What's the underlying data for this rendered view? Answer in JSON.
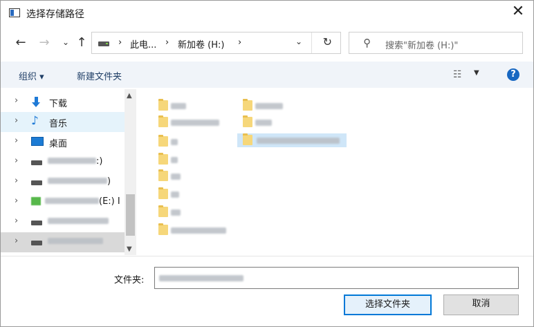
{
  "window": {
    "title": "选择存储路径",
    "close_icon": "close-icon"
  },
  "nav": {
    "back_icon": "←",
    "forward_icon": "→",
    "recent_icon": "⌄",
    "up_icon": "↑",
    "breadcrumb": [
      "此电...",
      "新加卷 (H:)"
    ],
    "breadcrumb_sep": "›",
    "dropdown_icon": "⌄",
    "refresh_icon": "↻"
  },
  "search": {
    "placeholder": "搜索\"新加卷 (H:)\""
  },
  "commandbar": {
    "organize": "组织 ▾",
    "new_folder": "新建文件夹",
    "view_dropdown": "▼",
    "help": "?"
  },
  "tree": {
    "items": [
      {
        "label": "下载",
        "icon": "download-icon"
      },
      {
        "label": "音乐",
        "icon": "music-icon"
      },
      {
        "label": "桌面",
        "icon": "desktop-icon"
      },
      {
        "label": ":)",
        "icon": "drive-icon"
      },
      {
        "label": ")",
        "icon": "drive-icon"
      },
      {
        "label": "(E:) I",
        "icon": "drive-icon"
      },
      {
        "label": "",
        "icon": "drive-icon"
      },
      {
        "label": "",
        "icon": "drive-icon"
      }
    ]
  },
  "bottom": {
    "folder_label": "文件夹:",
    "select_button": "选择文件夹",
    "cancel_button": "取消"
  }
}
